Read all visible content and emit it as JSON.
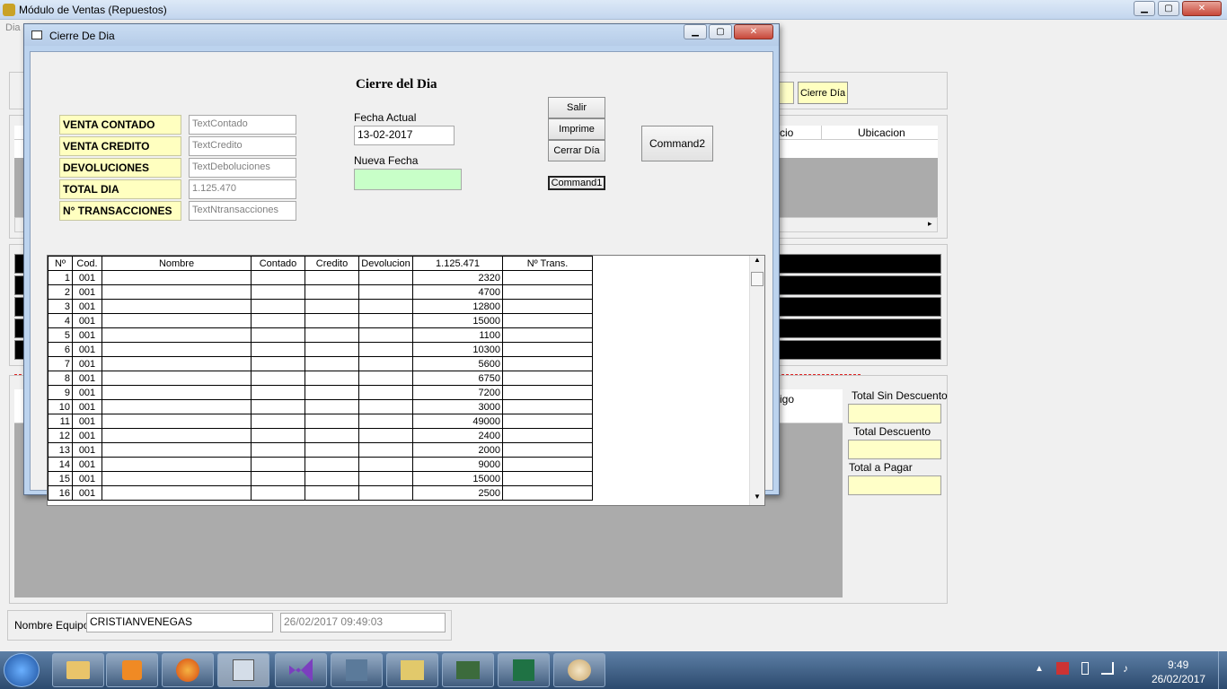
{
  "main_window": {
    "title": "Módulo de Ventas (Repuestos)",
    "menu_first": "Dia",
    "controls": {
      "minimize": "▁",
      "maximize": "▢",
      "close": "✕"
    },
    "cierre_dia_button": "Cierre Día",
    "list_headers": {
      "precio_partial": "cio",
      "ubicacion": "Ubicacion"
    },
    "codigo_partial": "igo",
    "totals": {
      "sin_descuento_label": "Total Sin Descuento",
      "descuento_label": "Total Descuento",
      "a_pagar_label": "Total a Pagar"
    },
    "footer": {
      "nombre_equipo_label": "Nombre Equipo",
      "nombre_equipo_value": "CRISTIANVENEGAS",
      "datetime_value": "26/02/2017 09:49:03"
    }
  },
  "dialog": {
    "title": "Cierre De Dia",
    "heading": "Cierre del Dia",
    "summary_rows": [
      {
        "label": "VENTA CONTADO",
        "value": "TextContado"
      },
      {
        "label": "VENTA CREDITO",
        "value": "TextCredito"
      },
      {
        "label": "DEVOLUCIONES",
        "value": "TextDeboluciones"
      },
      {
        "label": "TOTAL DIA",
        "value": "1.125.470"
      },
      {
        "label": "N° TRANSACCIONES",
        "value": "TextNtransacciones"
      }
    ],
    "fecha_actual_label": "Fecha Actual",
    "fecha_actual_value": "13-02-2017",
    "nueva_fecha_label": "Nueva Fecha",
    "nueva_fecha_value": "",
    "buttons": {
      "salir": "Salir",
      "imprime": "Imprime",
      "cerrar_dia": "Cerrar Día",
      "command1": "Command1",
      "command2": "Command2"
    },
    "grid": {
      "columns": [
        "Nº",
        "Cod.",
        "Nombre",
        "Contado",
        "Credito",
        "Devolucion",
        "1.125.471",
        "Nº Trans."
      ],
      "rows": [
        [
          "1",
          "001",
          "",
          "",
          "",
          "",
          "2320",
          ""
        ],
        [
          "2",
          "001",
          "",
          "",
          "",
          "",
          "4700",
          ""
        ],
        [
          "3",
          "001",
          "",
          "",
          "",
          "",
          "12800",
          ""
        ],
        [
          "4",
          "001",
          "",
          "",
          "",
          "",
          "15000",
          ""
        ],
        [
          "5",
          "001",
          "",
          "",
          "",
          "",
          "1100",
          ""
        ],
        [
          "6",
          "001",
          "",
          "",
          "",
          "",
          "10300",
          ""
        ],
        [
          "7",
          "001",
          "",
          "",
          "",
          "",
          "5600",
          ""
        ],
        [
          "8",
          "001",
          "",
          "",
          "",
          "",
          "6750",
          ""
        ],
        [
          "9",
          "001",
          "",
          "",
          "",
          "",
          "7200",
          ""
        ],
        [
          "10",
          "001",
          "",
          "",
          "",
          "",
          "3000",
          ""
        ],
        [
          "11",
          "001",
          "",
          "",
          "",
          "",
          "49000",
          ""
        ],
        [
          "12",
          "001",
          "",
          "",
          "",
          "",
          "2400",
          ""
        ],
        [
          "13",
          "001",
          "",
          "",
          "",
          "",
          "2000",
          ""
        ],
        [
          "14",
          "001",
          "",
          "",
          "",
          "",
          "9000",
          ""
        ],
        [
          "15",
          "001",
          "",
          "",
          "",
          "",
          "15000",
          ""
        ],
        [
          "16",
          "001",
          "",
          "",
          "",
          "",
          "2500",
          ""
        ]
      ]
    }
  },
  "taskbar": {
    "clock_time": "9:49",
    "clock_date": "26/02/2017"
  },
  "colors": {
    "yellow_field": "#ffffc8",
    "green_field": "#c8ffc8",
    "black_bar": "#000000",
    "gray_area": "#ababab"
  }
}
